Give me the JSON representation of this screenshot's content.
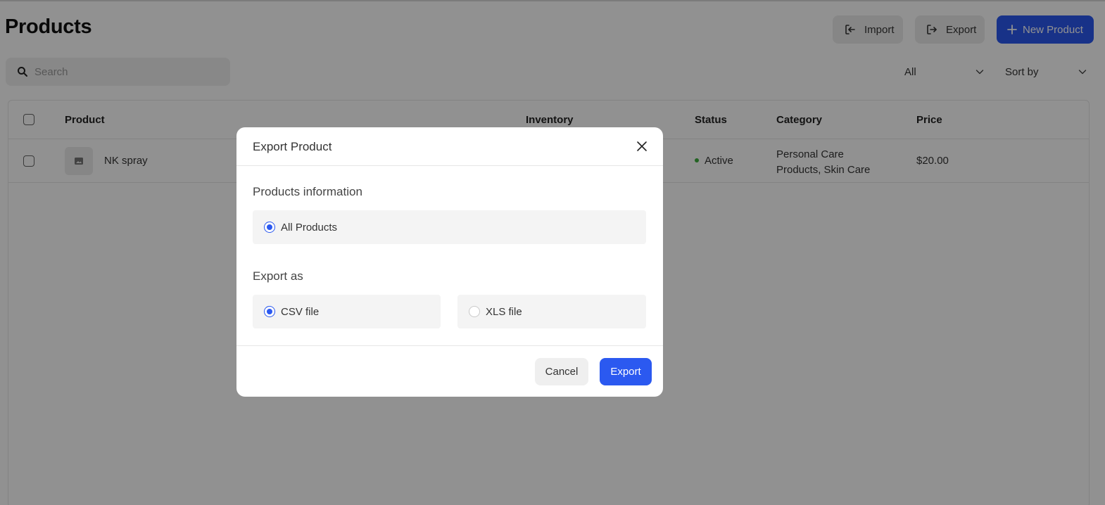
{
  "page": {
    "title": "Products",
    "import_label": "Import",
    "export_label": "Export",
    "new_product_label": "New Product",
    "search_placeholder": "Search",
    "status_filter_value": "All",
    "sort_label": "Sort by"
  },
  "table": {
    "columns": [
      "Product",
      "Inventory",
      "Status",
      "Category",
      "Price"
    ],
    "rows": [
      {
        "product": "NK spray",
        "inventory": "",
        "status": "Active",
        "category_line1": "Personal Care",
        "category_line2": "Products, Skin Care",
        "price": "$20.00"
      }
    ]
  },
  "modal": {
    "title": "Export Product",
    "section_info": "Products information",
    "option_all": "All Products",
    "section_format": "Export as",
    "option_csv": "CSV file",
    "option_xls": "XLS file",
    "selected_format": "csv",
    "cancel_label": "Cancel",
    "export_label": "Export"
  },
  "colors": {
    "accent": "#2b59f0",
    "status_active": "#3fae3f"
  },
  "icons": {
    "import": "import-icon",
    "export": "export-icon",
    "new": "plus-icon",
    "search": "search-icon",
    "chevron": "chevron-down-icon",
    "close": "close-icon",
    "image": "image-placeholder-icon"
  }
}
